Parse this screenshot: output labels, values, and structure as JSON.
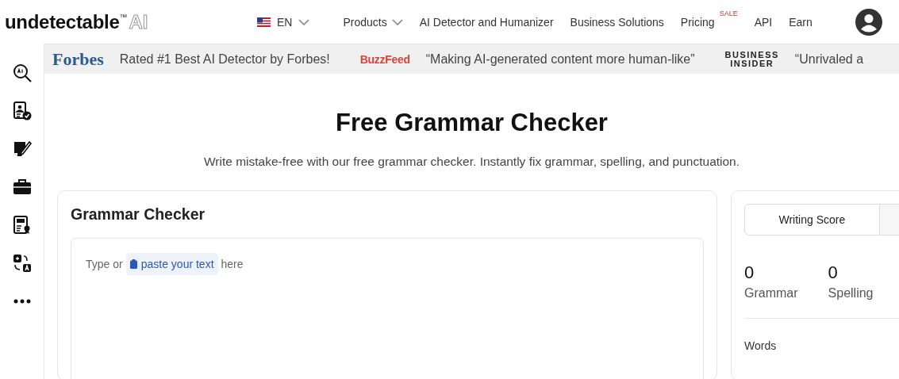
{
  "header": {
    "logo": {
      "name": "undetectable",
      "trademark": "™",
      "suffix": "AI"
    },
    "language": {
      "label": "EN",
      "dropdown": true
    },
    "nav": [
      {
        "label": "Products",
        "dropdown": true
      },
      {
        "label": "AI Detector and Humanizer",
        "dropdown": false
      },
      {
        "label": "Business Solutions",
        "dropdown": false
      },
      {
        "label": "Pricing",
        "dropdown": false,
        "badge": "SALE"
      },
      {
        "label": "API",
        "dropdown": false
      },
      {
        "label": "Earn",
        "dropdown": false
      }
    ]
  },
  "press": [
    {
      "kind": "forbes",
      "logo": "Forbes",
      "quote": "Rated #1 Best AI Detector by Forbes!"
    },
    {
      "kind": "buzzfeed",
      "logo": "BuzzFeed",
      "quote": "“Making AI-generated content more human-like”"
    },
    {
      "kind": "insider",
      "logo": "BUSINESS INSIDER",
      "quote": "“Unrivaled a"
    }
  ],
  "page": {
    "title": "Free Grammar Checker",
    "subtitle": "Write mistake-free with our free grammar checker. Instantly fix grammar, spelling, and punctuation."
  },
  "checker": {
    "title": "Grammar Checker",
    "prompt_before": "Type or",
    "paste_button": "paste your text",
    "prompt_after": "here"
  },
  "results": {
    "tabs": [
      {
        "label": "Writing Score",
        "selected": true
      }
    ],
    "stats": [
      {
        "value": "0",
        "label": "Grammar"
      },
      {
        "value": "0",
        "label": "Spelling"
      }
    ],
    "words_label": "Words"
  }
}
